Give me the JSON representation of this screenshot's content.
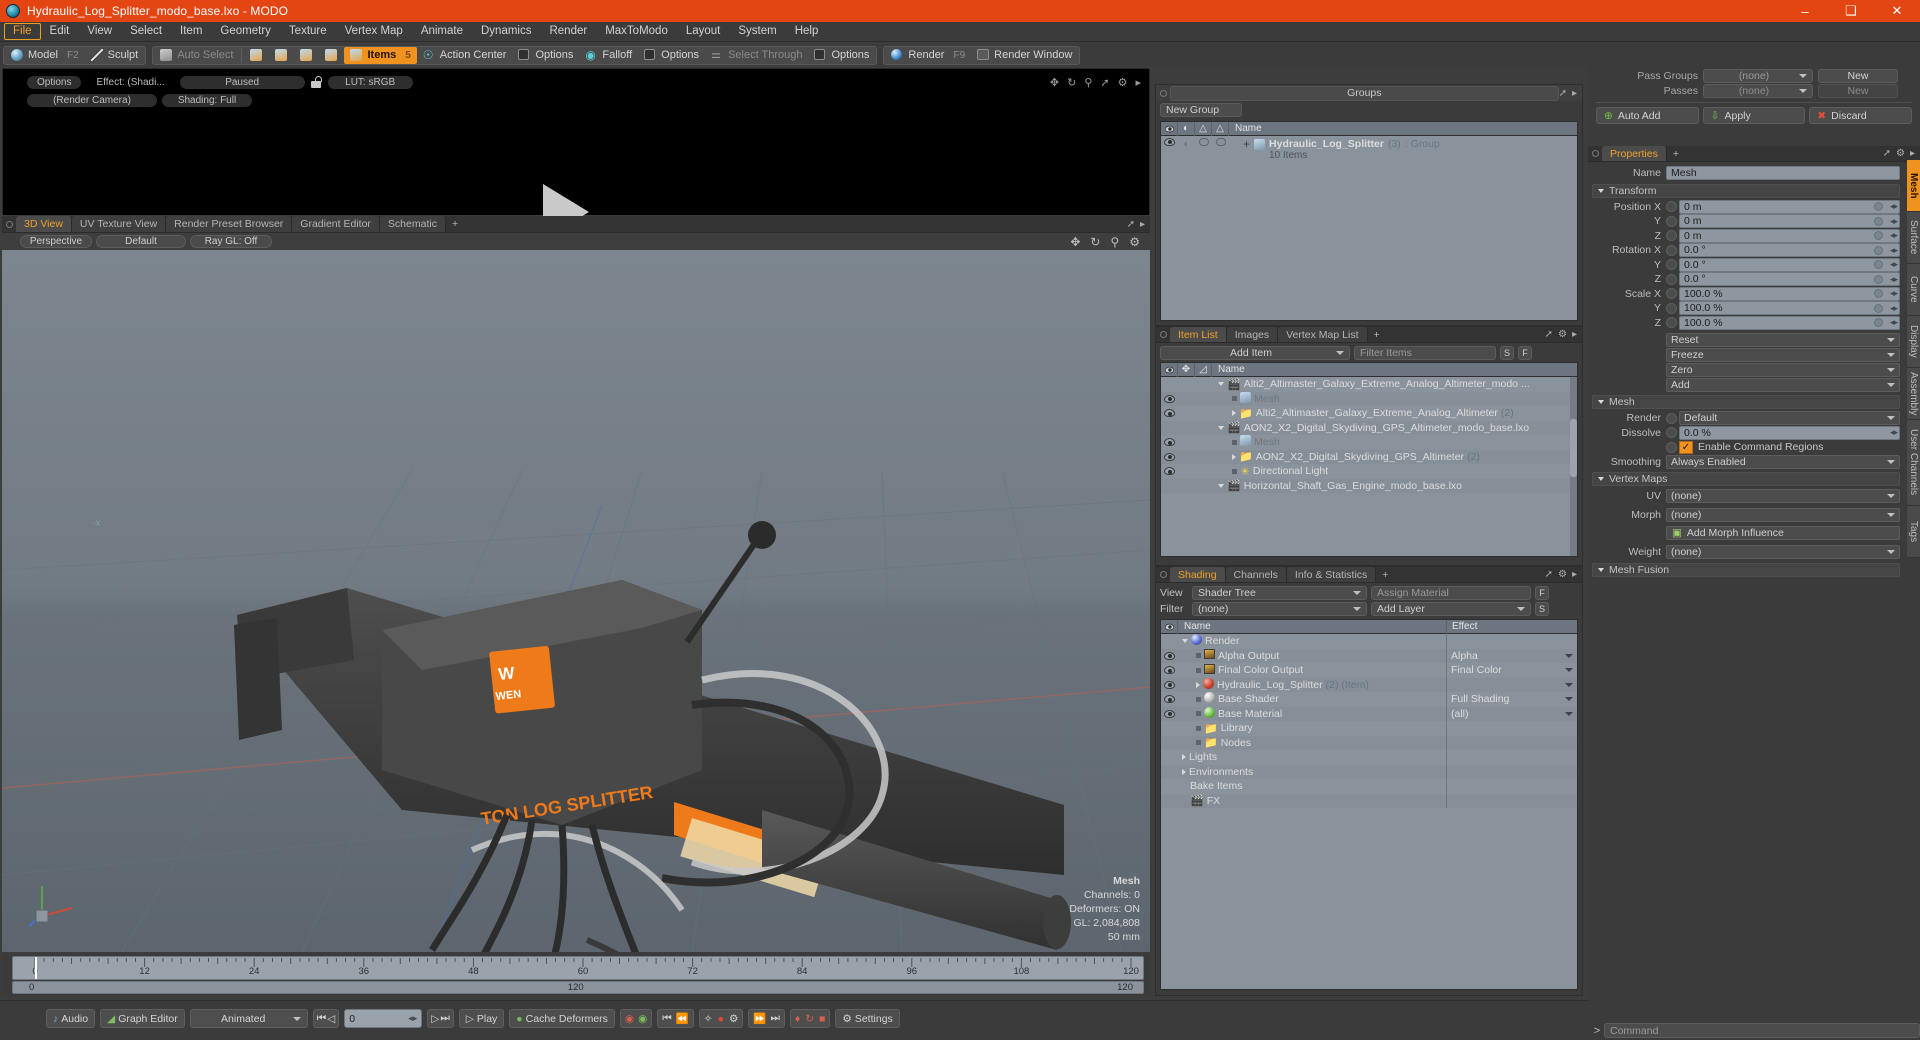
{
  "window": {
    "title": "Hydraulic_Log_Splitter_modo_base.lxo - MODO",
    "minimize": "–",
    "maximize": "❑",
    "close": "✕"
  },
  "menubar": {
    "items": [
      "File",
      "Edit",
      "View",
      "Select",
      "Item",
      "Geometry",
      "Texture",
      "Vertex Map",
      "Animate",
      "Dynamics",
      "Render",
      "MaxToModo",
      "Layout",
      "System",
      "Help"
    ],
    "active": "File"
  },
  "toolbar": {
    "groups": [
      {
        "buttons": [
          {
            "label": "Model",
            "icon": "sphere-icon",
            "state": "normal",
            "key": "F2"
          },
          {
            "label": "Sculpt",
            "icon": "brush-icon",
            "state": "normal",
            "key": ""
          }
        ]
      },
      {
        "buttons": [
          {
            "label": "Auto Select",
            "icon": "cube-grey-icon",
            "state": "dim",
            "key": ""
          },
          {
            "label": "",
            "icon": "vertex-icon",
            "state": "normal",
            "key": ""
          },
          {
            "label": "",
            "icon": "edge-icon",
            "state": "normal",
            "key": ""
          },
          {
            "label": "",
            "icon": "polygon-icon",
            "state": "normal",
            "key": ""
          },
          {
            "label": "",
            "icon": "material-icon",
            "state": "normal",
            "key": ""
          },
          {
            "label": "Items",
            "icon": "items-icon",
            "state": "on",
            "key": "5"
          },
          {
            "label": "Action Center",
            "icon": "action-center-icon",
            "state": "normal",
            "key": ""
          },
          {
            "label": "Options",
            "icon": "options-icon",
            "state": "normal",
            "key": ""
          },
          {
            "label": "Falloff",
            "icon": "falloff-icon",
            "state": "normal",
            "key": ""
          },
          {
            "label": "Options",
            "icon": "options-icon",
            "state": "normal",
            "key": ""
          },
          {
            "label": "Select Through",
            "icon": "select-through-icon",
            "state": "dim",
            "key": ""
          },
          {
            "label": "Options",
            "icon": "options-icon",
            "state": "normal",
            "key": ""
          }
        ]
      },
      {
        "buttons": [
          {
            "label": "Render",
            "icon": "render-icon",
            "state": "normal",
            "key": "F9"
          },
          {
            "label": "Render Window",
            "icon": "render-window-icon",
            "state": "normal",
            "key": ""
          }
        ]
      }
    ]
  },
  "preview": {
    "toolbar_row1": [
      "Options",
      "Effect: (Shadi...",
      "Paused"
    ],
    "lock_icon": "unlock-icon",
    "lut": "LUT: sRGB",
    "toolbar_row2": [
      "(Render Camera)",
      "Shading: Full"
    ],
    "play_overlay": "play-triangle-icon"
  },
  "viewport": {
    "tabs": [
      {
        "label": "3D View",
        "active": true
      },
      {
        "label": "UV Texture View",
        "active": false
      },
      {
        "label": "Render Preset Browser",
        "active": false
      },
      {
        "label": "Gradient Editor",
        "active": false
      },
      {
        "label": "Schematic",
        "active": false
      }
    ],
    "tab_add": "+",
    "header_buttons": [
      "Perspective",
      "Default",
      "Ray GL: Off"
    ],
    "icons": [
      "move-icon",
      "rotate-icon",
      "zoom-icon",
      "gear-icon"
    ],
    "hud": {
      "title": "Mesh",
      "lines": [
        "Channels: 0",
        "Deformers: ON",
        "GL: 2,084,808",
        "50 mm"
      ]
    },
    "axis_labels": {
      "x": "-x",
      "gizmo": "axis-gizmo"
    }
  },
  "groups_panel": {
    "title": "Groups",
    "new_group_button": "New Group",
    "columns": [
      "eye-icon",
      "render-icon",
      "lock-icon",
      "select-icon",
      "Name"
    ],
    "rows": [
      {
        "expander": "+",
        "name": "Hydraulic_Log_Splitter",
        "count": "(3)",
        "kind": ": Group",
        "sub": "10 Items"
      }
    ]
  },
  "item_list": {
    "tabs": [
      {
        "label": "Item List",
        "active": true
      },
      {
        "label": "Images",
        "active": false
      },
      {
        "label": "Vertex Map List",
        "active": false
      }
    ],
    "tab_add": "+",
    "add_item": "Add Item",
    "filter_placeholder": "Filter Items",
    "small_buttons": [
      "S",
      "F"
    ],
    "columns": [
      "eye-icon",
      "move-icon",
      "axis-icon",
      "Name"
    ],
    "rows": [
      {
        "indent": 0,
        "expander": "down",
        "icon": "scene-icon",
        "name": "Alti2_Altimaster_Galaxy_Extreme_Analog_Altimeter_modo ...",
        "count": "",
        "eye": false,
        "muted": false
      },
      {
        "indent": 1,
        "expander": "none",
        "icon": "mesh-icon",
        "name": "Mesh",
        "count": "",
        "eye": true,
        "muted": true
      },
      {
        "indent": 1,
        "expander": "right",
        "icon": "folder-icon",
        "name": "Alti2_Altimaster_Galaxy_Extreme_Analog_Altimeter",
        "count": "(2)",
        "eye": true,
        "muted": false
      },
      {
        "indent": 0,
        "expander": "down",
        "icon": "scene-icon",
        "name": "AON2_X2_Digital_Skydiving_GPS_Altimeter_modo_base.lxo",
        "count": "",
        "eye": false,
        "muted": false
      },
      {
        "indent": 1,
        "expander": "none",
        "icon": "mesh-icon",
        "name": "Mesh",
        "count": "",
        "eye": true,
        "muted": true
      },
      {
        "indent": 1,
        "expander": "right",
        "icon": "folder-icon",
        "name": "AON2_X2_Digital_Skydiving_GPS_Altimeter",
        "count": "(2)",
        "eye": true,
        "muted": false
      },
      {
        "indent": 1,
        "expander": "none",
        "icon": "light-icon",
        "name": "Directional Light",
        "count": "",
        "eye": true,
        "muted": false
      },
      {
        "indent": 0,
        "expander": "down",
        "icon": "scene-icon",
        "name": "Horizontal_Shaft_Gas_Engine_modo_base.lxo",
        "count": "",
        "eye": false,
        "muted": false
      }
    ]
  },
  "shading_panel": {
    "tabs": [
      {
        "label": "Shading",
        "active": true
      },
      {
        "label": "Channels",
        "active": false
      },
      {
        "label": "Info & Statistics",
        "active": false
      }
    ],
    "tab_add": "+",
    "view_label": "View",
    "view_value": "Shader Tree",
    "assign_material": "Assign Material",
    "filter_label": "Filter",
    "filter_value": "(none)",
    "add_layer": "Add Layer",
    "btn_f": "F",
    "btn_s": "S",
    "columns": [
      "eye-icon",
      "Name",
      "Effect"
    ],
    "rows": [
      {
        "indent": 0,
        "expander": "down",
        "icon": "render-ball-icon",
        "name": "Render",
        "extra": "",
        "effect": "",
        "eye": false,
        "dd": false
      },
      {
        "indent": 1,
        "expander": "none",
        "icon": "image-icon",
        "name": "Alpha Output",
        "extra": "",
        "effect": "Alpha",
        "eye": true,
        "dd": true
      },
      {
        "indent": 1,
        "expander": "none",
        "icon": "image-icon",
        "name": "Final Color Output",
        "extra": "",
        "effect": "Final Color",
        "eye": true,
        "dd": true
      },
      {
        "indent": 1,
        "expander": "right",
        "icon": "material-ball-icon",
        "name": "Hydraulic_Log_Splitter",
        "extra": "(2) (Item)",
        "effect": "",
        "eye": true,
        "dd": true
      },
      {
        "indent": 1,
        "expander": "none",
        "icon": "shader-ball-icon",
        "name": "Base Shader",
        "extra": "",
        "effect": "Full Shading",
        "eye": true,
        "dd": true
      },
      {
        "indent": 1,
        "expander": "none",
        "icon": "green-ball-icon",
        "name": "Base Material",
        "extra": "",
        "effect": "(all)",
        "eye": true,
        "dd": true
      },
      {
        "indent": 1,
        "expander": "none",
        "icon": "folder-icon",
        "name": "Library",
        "extra": "",
        "effect": "",
        "eye": false,
        "dd": false
      },
      {
        "indent": 1,
        "expander": "none",
        "icon": "folder-icon",
        "name": "Nodes",
        "extra": "",
        "effect": "",
        "eye": false,
        "dd": false
      },
      {
        "indent": 0,
        "expander": "right",
        "icon": "none",
        "name": "Lights",
        "extra": "",
        "effect": "",
        "eye": false,
        "dd": false
      },
      {
        "indent": 0,
        "expander": "right",
        "icon": "none",
        "name": "Environments",
        "extra": "",
        "effect": "",
        "eye": false,
        "dd": false
      },
      {
        "indent": 0,
        "expander": "none",
        "icon": "none",
        "name": "Bake Items",
        "extra": "",
        "effect": "",
        "eye": false,
        "dd": false
      },
      {
        "indent": 0,
        "expander": "none",
        "icon": "scene-icon",
        "name": "FX",
        "extra": "",
        "effect": "",
        "eye": false,
        "dd": false
      }
    ]
  },
  "passes_panel": {
    "pass_groups_label": "Pass Groups",
    "pass_groups_value": "(none)",
    "pass_groups_new": "New",
    "passes_label": "Passes",
    "passes_value": "(none)",
    "passes_new": "New",
    "auto_add": "Auto Add",
    "apply": "Apply",
    "discard": "Discard"
  },
  "properties": {
    "tabs": [
      {
        "label": "Properties",
        "active": true
      }
    ],
    "tab_add": "+",
    "name_label": "Name",
    "name_value": "Mesh",
    "transform_header": "Transform",
    "transform": [
      {
        "label": "Position X",
        "value": "0 m"
      },
      {
        "label": "Y",
        "value": "0 m"
      },
      {
        "label": "Z",
        "value": "0 m"
      },
      {
        "label": "Rotation X",
        "value": "0.0 °"
      },
      {
        "label": "Y",
        "value": "0.0 °"
      },
      {
        "label": "Z",
        "value": "0.0 °"
      },
      {
        "label": "Scale X",
        "value": "100.0 %"
      },
      {
        "label": "Y",
        "value": "100.0 %"
      },
      {
        "label": "Z",
        "value": "100.0 %"
      }
    ],
    "transform_actions": [
      "Reset",
      "Freeze",
      "Zero",
      "Add"
    ],
    "mesh_header": "Mesh",
    "mesh": {
      "render_label": "Render",
      "render_value": "Default",
      "dissolve_label": "Dissolve",
      "dissolve_value": "0.0 %",
      "enable_command_regions": "Enable Command Regions",
      "enable_command_regions_checked": true,
      "smoothing_label": "Smoothing",
      "smoothing_value": "Always Enabled"
    },
    "vertex_maps_header": "Vertex Maps",
    "vertex_maps": {
      "uv_label": "UV",
      "uv_value": "(none)",
      "morph_label": "Morph",
      "morph_value": "(none)",
      "add_morph_influence": "Add Morph Influence",
      "weight_label": "Weight",
      "weight_value": "(none)"
    },
    "mesh_fusion_header": "Mesh Fusion",
    "side_tabs": [
      {
        "label": "Mesh",
        "active": true
      },
      {
        "label": "Surface",
        "active": false
      },
      {
        "label": "Curve",
        "active": false
      },
      {
        "label": "Display",
        "active": false
      },
      {
        "label": "Assembly",
        "active": false
      },
      {
        "label": "User Channels",
        "active": false
      },
      {
        "label": "Tags",
        "active": false
      }
    ]
  },
  "timeline": {
    "ticks": [
      "0",
      "12",
      "24",
      "36",
      "48",
      "60",
      "72",
      "84",
      "96",
      "108",
      "120"
    ],
    "range_start": "0",
    "range_mid": "120",
    "range_end": "120"
  },
  "statusbar": {
    "audio": "Audio",
    "graph_editor": "Graph Editor",
    "mode": "Animated",
    "frame_value": "0",
    "play": "Play",
    "cache_deformers": "Cache Deformers",
    "settings": "Settings",
    "transport_icons": [
      "skip-start-icon",
      "step-back-icon",
      "step-forward-icon",
      "skip-end-icon"
    ],
    "key_icons": [
      "key-red-icon",
      "key-green-icon",
      "prev-key-icon",
      "first-key-icon",
      "auto-key-icon",
      "record-icon",
      "key-filter-icon",
      "next-key-icon",
      "last-key-icon",
      "key-a-icon",
      "key-cycle-icon",
      "key-delete-icon"
    ]
  },
  "command_bar": {
    "prompt": ">",
    "placeholder": "Command"
  },
  "colors": {
    "accent": "#f0921e",
    "title_bar": "#e34612",
    "panel_bg": "#3b3b3b",
    "list_bg": "#8a939c",
    "header_bg": "#6d7680"
  }
}
